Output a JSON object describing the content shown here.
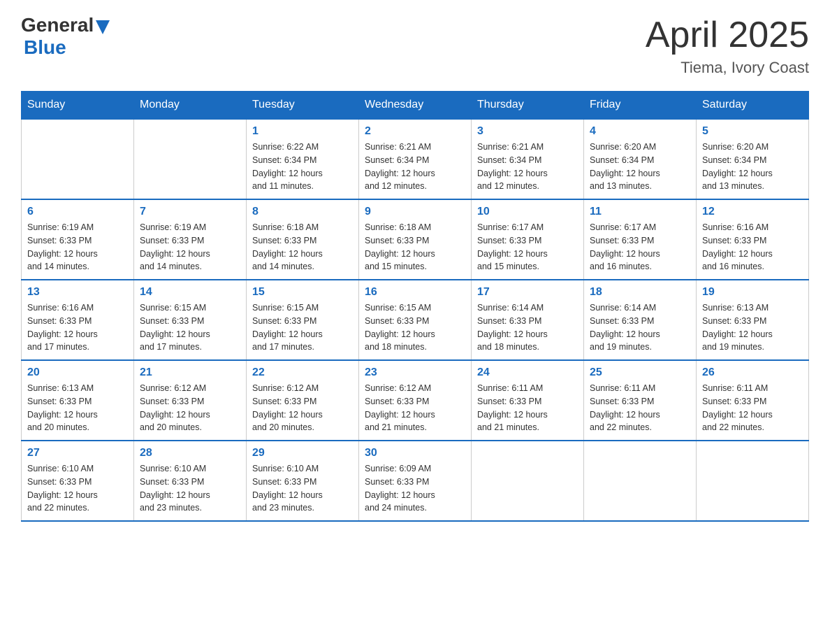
{
  "header": {
    "logo": {
      "general": "General",
      "triangle_aria": "blue triangle",
      "blue": "Blue"
    },
    "month_title": "April 2025",
    "location": "Tiema, Ivory Coast"
  },
  "weekdays": [
    "Sunday",
    "Monday",
    "Tuesday",
    "Wednesday",
    "Thursday",
    "Friday",
    "Saturday"
  ],
  "weeks": [
    {
      "days": [
        {
          "number": "",
          "info": ""
        },
        {
          "number": "",
          "info": ""
        },
        {
          "number": "1",
          "info": "Sunrise: 6:22 AM\nSunset: 6:34 PM\nDaylight: 12 hours\nand 11 minutes."
        },
        {
          "number": "2",
          "info": "Sunrise: 6:21 AM\nSunset: 6:34 PM\nDaylight: 12 hours\nand 12 minutes."
        },
        {
          "number": "3",
          "info": "Sunrise: 6:21 AM\nSunset: 6:34 PM\nDaylight: 12 hours\nand 12 minutes."
        },
        {
          "number": "4",
          "info": "Sunrise: 6:20 AM\nSunset: 6:34 PM\nDaylight: 12 hours\nand 13 minutes."
        },
        {
          "number": "5",
          "info": "Sunrise: 6:20 AM\nSunset: 6:34 PM\nDaylight: 12 hours\nand 13 minutes."
        }
      ]
    },
    {
      "days": [
        {
          "number": "6",
          "info": "Sunrise: 6:19 AM\nSunset: 6:33 PM\nDaylight: 12 hours\nand 14 minutes."
        },
        {
          "number": "7",
          "info": "Sunrise: 6:19 AM\nSunset: 6:33 PM\nDaylight: 12 hours\nand 14 minutes."
        },
        {
          "number": "8",
          "info": "Sunrise: 6:18 AM\nSunset: 6:33 PM\nDaylight: 12 hours\nand 14 minutes."
        },
        {
          "number": "9",
          "info": "Sunrise: 6:18 AM\nSunset: 6:33 PM\nDaylight: 12 hours\nand 15 minutes."
        },
        {
          "number": "10",
          "info": "Sunrise: 6:17 AM\nSunset: 6:33 PM\nDaylight: 12 hours\nand 15 minutes."
        },
        {
          "number": "11",
          "info": "Sunrise: 6:17 AM\nSunset: 6:33 PM\nDaylight: 12 hours\nand 16 minutes."
        },
        {
          "number": "12",
          "info": "Sunrise: 6:16 AM\nSunset: 6:33 PM\nDaylight: 12 hours\nand 16 minutes."
        }
      ]
    },
    {
      "days": [
        {
          "number": "13",
          "info": "Sunrise: 6:16 AM\nSunset: 6:33 PM\nDaylight: 12 hours\nand 17 minutes."
        },
        {
          "number": "14",
          "info": "Sunrise: 6:15 AM\nSunset: 6:33 PM\nDaylight: 12 hours\nand 17 minutes."
        },
        {
          "number": "15",
          "info": "Sunrise: 6:15 AM\nSunset: 6:33 PM\nDaylight: 12 hours\nand 17 minutes."
        },
        {
          "number": "16",
          "info": "Sunrise: 6:15 AM\nSunset: 6:33 PM\nDaylight: 12 hours\nand 18 minutes."
        },
        {
          "number": "17",
          "info": "Sunrise: 6:14 AM\nSunset: 6:33 PM\nDaylight: 12 hours\nand 18 minutes."
        },
        {
          "number": "18",
          "info": "Sunrise: 6:14 AM\nSunset: 6:33 PM\nDaylight: 12 hours\nand 19 minutes."
        },
        {
          "number": "19",
          "info": "Sunrise: 6:13 AM\nSunset: 6:33 PM\nDaylight: 12 hours\nand 19 minutes."
        }
      ]
    },
    {
      "days": [
        {
          "number": "20",
          "info": "Sunrise: 6:13 AM\nSunset: 6:33 PM\nDaylight: 12 hours\nand 20 minutes."
        },
        {
          "number": "21",
          "info": "Sunrise: 6:12 AM\nSunset: 6:33 PM\nDaylight: 12 hours\nand 20 minutes."
        },
        {
          "number": "22",
          "info": "Sunrise: 6:12 AM\nSunset: 6:33 PM\nDaylight: 12 hours\nand 20 minutes."
        },
        {
          "number": "23",
          "info": "Sunrise: 6:12 AM\nSunset: 6:33 PM\nDaylight: 12 hours\nand 21 minutes."
        },
        {
          "number": "24",
          "info": "Sunrise: 6:11 AM\nSunset: 6:33 PM\nDaylight: 12 hours\nand 21 minutes."
        },
        {
          "number": "25",
          "info": "Sunrise: 6:11 AM\nSunset: 6:33 PM\nDaylight: 12 hours\nand 22 minutes."
        },
        {
          "number": "26",
          "info": "Sunrise: 6:11 AM\nSunset: 6:33 PM\nDaylight: 12 hours\nand 22 minutes."
        }
      ]
    },
    {
      "days": [
        {
          "number": "27",
          "info": "Sunrise: 6:10 AM\nSunset: 6:33 PM\nDaylight: 12 hours\nand 22 minutes."
        },
        {
          "number": "28",
          "info": "Sunrise: 6:10 AM\nSunset: 6:33 PM\nDaylight: 12 hours\nand 23 minutes."
        },
        {
          "number": "29",
          "info": "Sunrise: 6:10 AM\nSunset: 6:33 PM\nDaylight: 12 hours\nand 23 minutes."
        },
        {
          "number": "30",
          "info": "Sunrise: 6:09 AM\nSunset: 6:33 PM\nDaylight: 12 hours\nand 24 minutes."
        },
        {
          "number": "",
          "info": ""
        },
        {
          "number": "",
          "info": ""
        },
        {
          "number": "",
          "info": ""
        }
      ]
    }
  ]
}
